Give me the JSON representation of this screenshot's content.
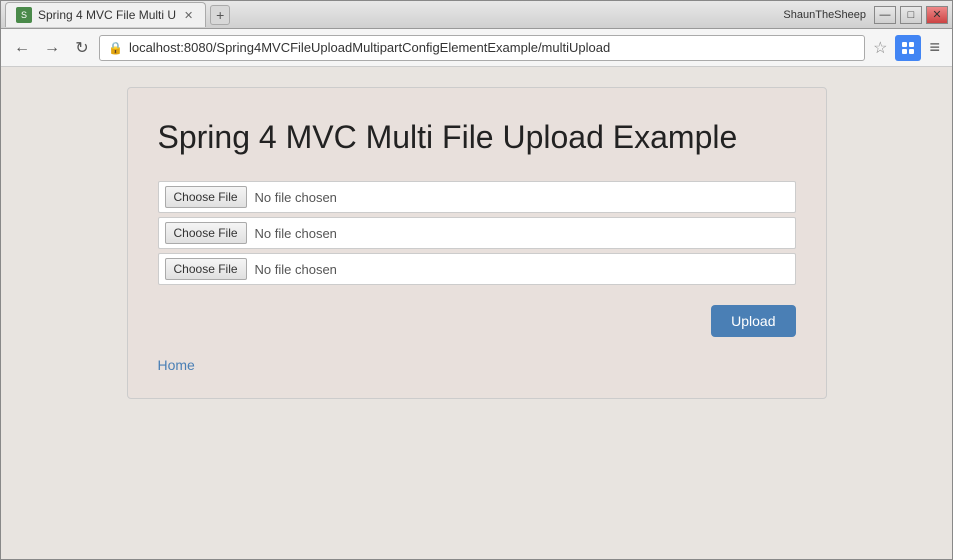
{
  "browser": {
    "user_label": "ShaunTheSheep",
    "tab_title": "Spring 4 MVC File Multi U",
    "tab_icon_text": "S",
    "window_buttons": {
      "minimize": "—",
      "maximize": "□",
      "close": "✕"
    }
  },
  "nav": {
    "back_icon": "←",
    "forward_icon": "→",
    "reload_icon": "↻",
    "address": "localhost:8080/Spring4MVCFileUploadMultipartConfigElementExample/multiUpload",
    "star_icon": "☆",
    "menu_icon": "≡"
  },
  "page": {
    "title": "Spring 4 MVC Multi File Upload Example",
    "file_inputs": [
      {
        "button_label": "Choose File",
        "placeholder": "No file chosen"
      },
      {
        "button_label": "Choose File",
        "placeholder": "No file chosen"
      },
      {
        "button_label": "Choose File",
        "placeholder": "No file chosen"
      }
    ],
    "upload_button": "Upload",
    "home_link": "Home"
  }
}
